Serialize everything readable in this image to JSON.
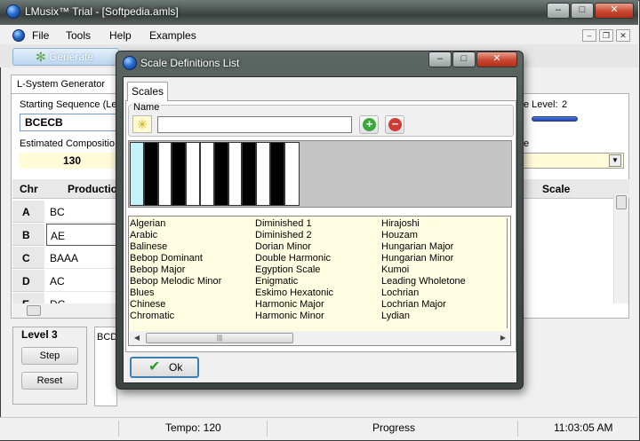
{
  "main_window": {
    "title": "LMusix™ Trial - [Softpedia.amls]",
    "controls": {
      "minimize": "–",
      "maximize": "□",
      "close": "✕"
    },
    "mdi_controls": {
      "minimize": "–",
      "restore": "❐",
      "close": "✕"
    }
  },
  "menu": [
    "File",
    "Tools",
    "Help",
    "Examples"
  ],
  "toolbar": {
    "generate_label": "Generate",
    "generate_icon": "gear-icon"
  },
  "lsystem": {
    "tab_label": "L-System Generator",
    "starting_sequence_label": "Starting Sequence (Le",
    "starting_sequence_value": "BCECB",
    "estimated_label": "Estimated Compositio",
    "estimated_value": "130",
    "level_label": "e Level:",
    "level_value": "2",
    "scale_label": "e"
  },
  "grid": {
    "headers": {
      "chr": "Chr",
      "production": "Production",
      "scale": "Scale"
    },
    "rows": [
      {
        "chr": "A",
        "production": "BC"
      },
      {
        "chr": "B",
        "production": "AE"
      },
      {
        "chr": "C",
        "production": "BAAA"
      },
      {
        "chr": "D",
        "production": "AC"
      },
      {
        "chr": "E",
        "production": "DC"
      }
    ]
  },
  "level_panel": {
    "title": "Level 3",
    "step_label": "Step",
    "reset_label": "Reset",
    "output_text": "BCD"
  },
  "statusbar": {
    "tempo": "Tempo:  120",
    "progress": "Progress",
    "time": "11:03:05 AM"
  },
  "dialog": {
    "title": "Scale Definitions List",
    "controls": {
      "minimize": "–",
      "maximize": "□",
      "close": "✕"
    },
    "tab_label": "Scales",
    "name_group_label": "Name",
    "name_value": "",
    "add_icon": "plus-icon",
    "remove_icon": "minus-icon",
    "scales_columns": [
      [
        "Algerian",
        "Arabic",
        "Balinese",
        "Bebop Dominant",
        "Bebop Major",
        "Bebop Melodic Minor",
        "Blues",
        "Chinese",
        "Chromatic"
      ],
      [
        "Diminished 1",
        "Diminished 2",
        "Dorian Minor",
        "Double Harmonic",
        "Egyption Scale",
        "Enigmatic",
        "Eskimo Hexatonic",
        "Harmonic Major",
        "Harmonic Minor"
      ],
      [
        "Hirajoshi",
        "Houzam",
        "Hungarian Major",
        "Hungarian Minor",
        "Kumoi",
        "Leading Wholetone",
        "Lochrian",
        "Lochrian Major",
        "Lydian"
      ]
    ],
    "ok_label": "Ok"
  },
  "colors": {
    "list_background": "#fffde1",
    "highlight_key": "#c4f2f6",
    "accent": "#3c7fb1"
  }
}
